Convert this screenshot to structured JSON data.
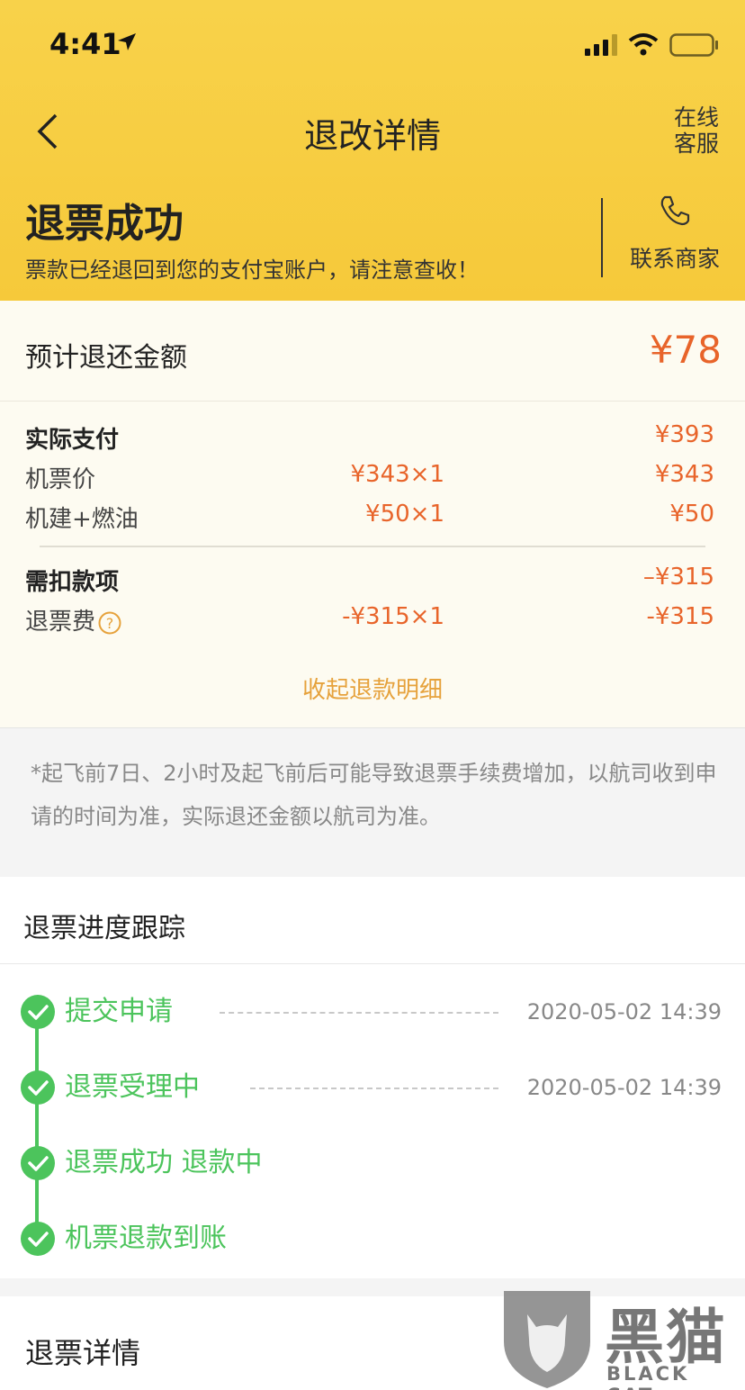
{
  "status_bar": {
    "time": "4:41"
  },
  "nav": {
    "title": "退改详情",
    "service_line1": "在线",
    "service_line2": "客服"
  },
  "status": {
    "title": "退票成功",
    "message": "票款已经退回到您的支付宝账户，请注意查收！",
    "contact_label": "联系商家"
  },
  "estimate": {
    "label": "预计退还金额",
    "amount": "¥78"
  },
  "breakdown": {
    "paid": {
      "label": "实际支付",
      "total": "¥393"
    },
    "ticket": {
      "label": "机票价",
      "unit": "¥343×1",
      "total": "¥343"
    },
    "tax": {
      "label": "机建+燃油",
      "unit": "¥50×1",
      "total": "¥50"
    },
    "deduct": {
      "label": "需扣款项",
      "total": "–¥315"
    },
    "fee": {
      "label": "退票费",
      "unit": "-¥315×1",
      "total": "-¥315"
    },
    "collapse": "收起退款明细"
  },
  "notice": "*起飞前7日、2小时及起飞前后可能导致退票手续费增加，以航司收到申请的时间为准，实际退还金额以航司为准。",
  "progress": {
    "title": "退票进度跟踪",
    "steps": [
      {
        "label": "提交申请",
        "time": "2020-05-02 14:39"
      },
      {
        "label": "退票受理中",
        "time": "2020-05-02 14:39"
      },
      {
        "label": "退票成功 退款中"
      },
      {
        "label": "机票退款到账"
      }
    ]
  },
  "details": {
    "title": "退票详情"
  },
  "watermark": {
    "cn": "黑猫",
    "en": "BLACK CAT"
  },
  "colors": {
    "header": "#f7cb3f",
    "accent": "#e8642a",
    "success": "#4cc45c",
    "link": "#e6a23c"
  }
}
